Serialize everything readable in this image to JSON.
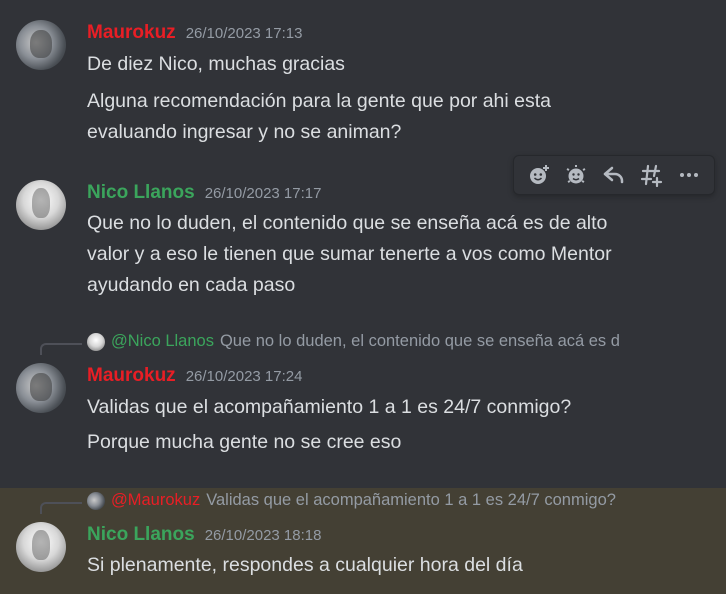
{
  "messages": [
    {
      "author": "Maurokuz",
      "timestamp": "26/10/2023 17:13",
      "lines": [
        "De diez Nico, muchas gracias",
        "Alguna recomendación para la gente que por ahi esta",
        "evaluando ingresar y no se animan?"
      ]
    },
    {
      "author": "Nico Llanos",
      "timestamp": "26/10/2023 17:17",
      "lines": [
        "Que no lo duden, el contenido que se enseña acá es de alto",
        "valor y a eso le tienen que sumar tenerte a vos como Mentor",
        "ayudando en cada paso"
      ]
    },
    {
      "reply": {
        "mention": "@Nico Llanos",
        "text": "Que no lo duden, el contenido que se enseña acá es d"
      },
      "author": "Maurokuz",
      "timestamp": "26/10/2023 17:24",
      "lines": [
        "Validas que el acompañamiento 1 a 1 es 24/7 conmigo?",
        "Porque mucha gente no se cree eso"
      ]
    },
    {
      "reply": {
        "mention": "@Maurokuz",
        "text": "Validas que el acompañamiento 1 a 1 es 24/7 conmigo?"
      },
      "author": "Nico Llanos",
      "timestamp": "26/10/2023 18:18",
      "lines": [
        "Si plenamente, respondes a cualquier hora del día"
      ]
    }
  ],
  "toolbar": {
    "icons": [
      "add-reaction-icon",
      "super-reaction-icon",
      "reply-icon",
      "create-thread-icon",
      "more-options-icon"
    ]
  },
  "colors": {
    "background": "#313338",
    "highlight": "#444034",
    "maurokuz": "#e91e25",
    "nico": "#3ba55c",
    "timestamp": "#949ba4",
    "text": "#dbdee1"
  }
}
